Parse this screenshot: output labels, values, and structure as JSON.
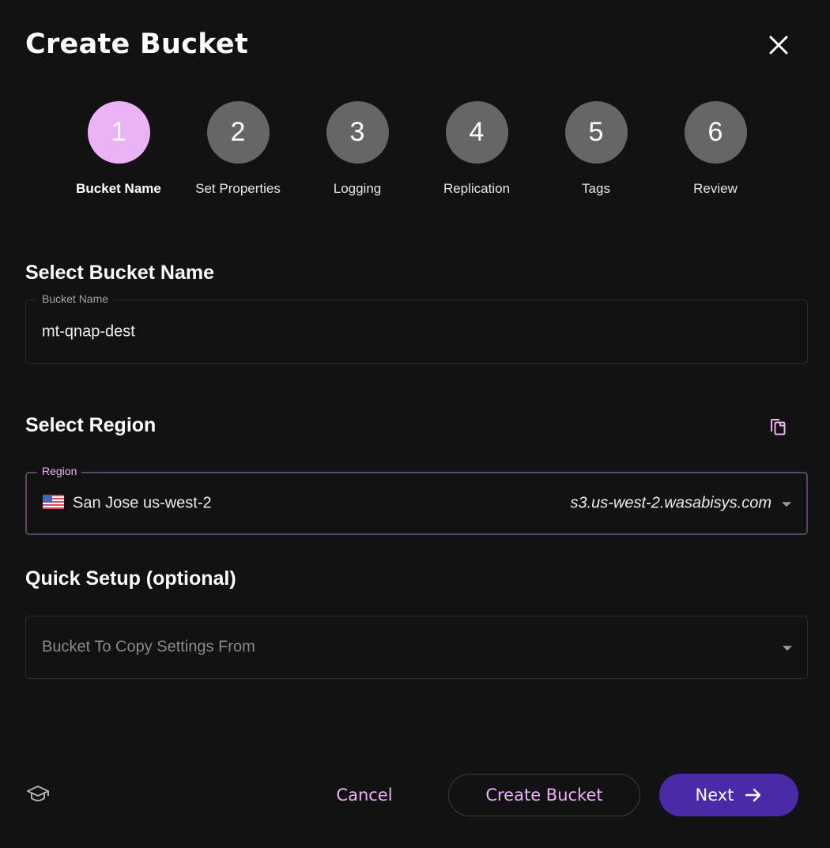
{
  "dialog": {
    "title": "Create Bucket"
  },
  "stepper": {
    "steps": [
      {
        "number": "1",
        "label": "Bucket Name"
      },
      {
        "number": "2",
        "label": "Set Properties"
      },
      {
        "number": "3",
        "label": "Logging"
      },
      {
        "number": "4",
        "label": "Replication"
      },
      {
        "number": "5",
        "label": "Tags"
      },
      {
        "number": "6",
        "label": "Review"
      }
    ],
    "active_step": 1
  },
  "bucket_name": {
    "section_title": "Select Bucket Name",
    "field_label": "Bucket Name",
    "value": "mt-qnap-dest"
  },
  "region": {
    "section_title": "Select Region",
    "field_label": "Region",
    "name": "San Jose us-west-2",
    "endpoint": "s3.us-west-2.wasabisys.com",
    "flag_icon": "us-flag-icon"
  },
  "quick_setup": {
    "section_title": "Quick Setup (optional)",
    "placeholder": "Bucket To Copy Settings From"
  },
  "footer": {
    "cancel_label": "Cancel",
    "create_label": "Create Bucket",
    "next_label": "Next"
  },
  "colors": {
    "accent": "#ebb3f6",
    "primary": "#4a2aa6",
    "background": "#121212",
    "step_inactive": "#666666"
  }
}
